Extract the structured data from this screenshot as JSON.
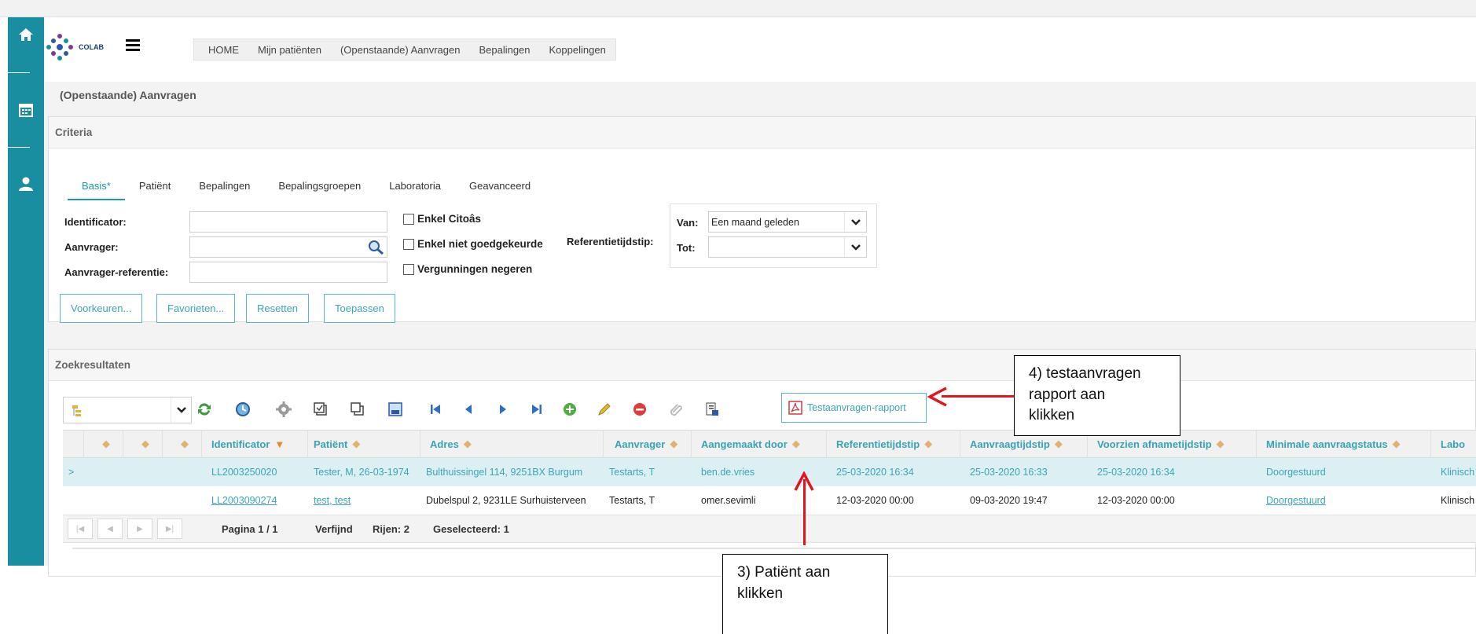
{
  "app": {
    "logo_text": "COLAB",
    "nav": [
      "HOME",
      "Mijn patiënten",
      "(Openstaande) Aanvragen",
      "Bepalingen",
      "Koppelingen"
    ],
    "page_title": "(Openstaande) Aanvragen"
  },
  "criteria": {
    "title": "Criteria",
    "tabs": [
      "Basis*",
      "Patiënt",
      "Bepalingen",
      "Bepalingsgroepen",
      "Laboratoria",
      "Geavanceerd"
    ],
    "fields": {
      "identificator": "Identificator:",
      "aanvrager": "Aanvrager:",
      "referentie": "Aanvrager-referentie:"
    },
    "checkboxes": [
      "Enkel Citoâs",
      "Enkel niet goedgekeurde",
      "Vergunningen negeren"
    ],
    "ref_label": "Referentietijdstip:",
    "van_label": "Van:",
    "van_value": "Een maand geleden",
    "tot_label": "Tot:",
    "tot_value": "",
    "buttons": [
      "Voorkeuren...",
      "Favorieten...",
      "Resetten",
      "Toepassen"
    ]
  },
  "results": {
    "title": "Zoekresultaten",
    "rapport_label": "Testaanvragen-rapport",
    "columns": [
      "Identificator",
      "Patiënt",
      "Adres",
      "Aanvrager",
      "Aangemaakt door",
      "Referentietijdstip",
      "Aanvraagtijdstip",
      "Voorzien afnametijdstip",
      "Minimale aanvraagstatus",
      "Labo"
    ],
    "rows": [
      {
        "marker": ">",
        "id": "LL2003250020",
        "patient": "Tester, M, 26-03-1974",
        "adres": "Bulthuissingel 114, 9251BX Burgum",
        "aanvrager": "Testarts, T",
        "aangemaakt": "ben.de.vries",
        "ref": "25-03-2020 16:34",
        "aanvraag": "25-03-2020 16:33",
        "afname": "25-03-2020 16:34",
        "status": "Doorgestuurd",
        "labo": "Klinisch"
      },
      {
        "marker": "",
        "id": "LL2003090274",
        "patient": "test, test",
        "adres": "Dubelspul 2, 9231LE Surhuisterveen",
        "aanvrager": "Testarts, T",
        "aangemaakt": "omer.sevimli",
        "ref": "12-03-2020 00:00",
        "aanvraag": "09-03-2020 19:47",
        "afname": "12-03-2020 00:00",
        "status": "Doorgestuurd",
        "labo": "Klinisch"
      }
    ],
    "pager": {
      "pagina": "Pagina 1 / 1",
      "verfijnd": "Verfijnd",
      "rijen": "Rijen: 2",
      "geselecteerd": "Geselecteerd: 1"
    }
  },
  "annotations": {
    "step4": [
      "4) testaanvragen",
      "rapport aan",
      "klikken"
    ],
    "step3": [
      "3) Patiënt aan",
      "klikken"
    ]
  },
  "colors": {
    "accent": "#1a8ea1",
    "link": "#3ba6b5",
    "arrow": "#e0161f"
  }
}
